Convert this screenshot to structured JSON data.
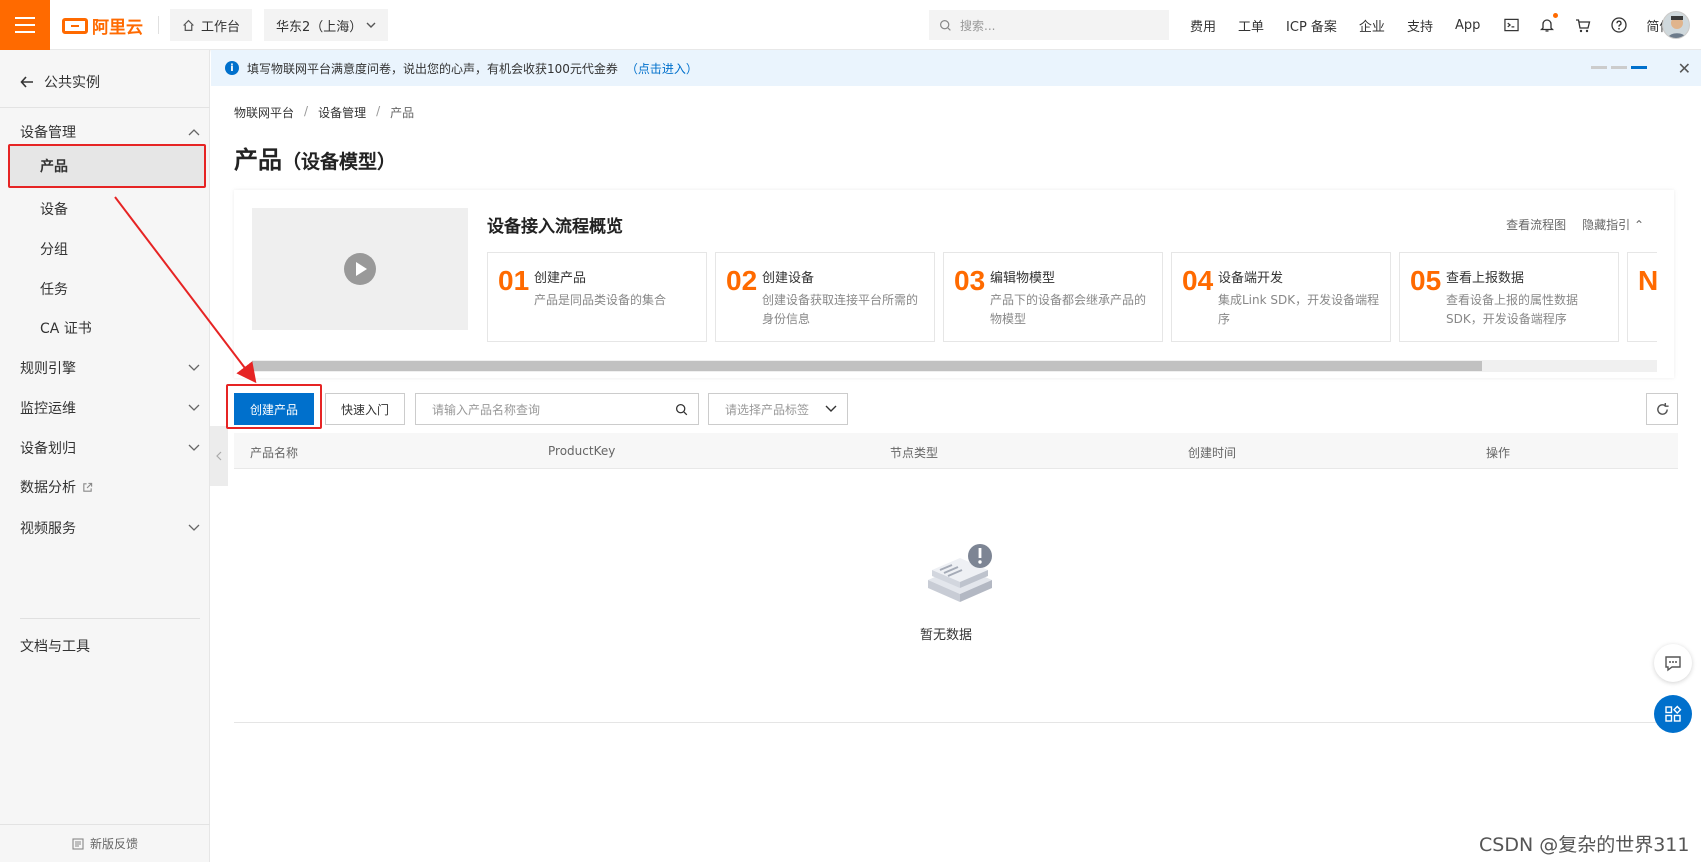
{
  "topbar": {
    "brand": "阿里云",
    "workbench_label": "工作台",
    "region_label": "华东2（上海）",
    "search_placeholder": "搜索...",
    "links": [
      "费用",
      "工单",
      "ICP 备案",
      "企业",
      "支持",
      "App"
    ],
    "language": "简体"
  },
  "sidebar": {
    "back_label": "公共实例",
    "group_device_mgmt": "设备管理",
    "items": [
      "产品",
      "设备",
      "分组",
      "任务",
      "CA 证书"
    ],
    "groups": [
      "规则引擎",
      "监控运维",
      "设备划归",
      "数据分析",
      "视频服务"
    ],
    "docs_label": "文档与工具",
    "feedback_label": "新版反馈"
  },
  "notice": {
    "text": "填写物联网平台满意度问卷，说出您的心声，有机会收获100元代金券",
    "link": "（点击进入）"
  },
  "breadcrumb": [
    "物联网平台",
    "设备管理",
    "产品"
  ],
  "page": {
    "title": "产品",
    "title_suffix": "（设备模型）"
  },
  "guide": {
    "title": "设备接入流程概览",
    "view_flow": "查看流程图",
    "hide_guide": "隐藏指引",
    "steps": [
      {
        "num": "01",
        "title": "创建产品",
        "desc": "产品是同品类设备的集合"
      },
      {
        "num": "02",
        "title": "创建设备",
        "desc": "创建设备获取连接平台所需的身份信息"
      },
      {
        "num": "03",
        "title": "编辑物模型",
        "desc": "产品下的设备都会继承产品的物模型"
      },
      {
        "num": "04",
        "title": "设备端开发",
        "desc": "集成Link SDK，开发设备端程序"
      },
      {
        "num": "05",
        "title": "查看上报数据",
        "desc": "查看设备上报的属性数据SDK，开发设备端程序"
      },
      {
        "num": "Nex",
        "title": "",
        "desc": ""
      }
    ]
  },
  "toolbar": {
    "create_label": "创建产品",
    "quickstart_label": "快速入门",
    "search_placeholder": "请输入产品名称查询",
    "tag_placeholder": "请选择产品标签"
  },
  "table": {
    "columns": [
      "产品名称",
      "ProductKey",
      "节点类型",
      "创建时间",
      "操作"
    ],
    "empty_text": "暂无数据"
  },
  "watermark": "CSDN @复杂的世界311",
  "colors": {
    "brand": "#ff6a00",
    "primary": "#0070cc",
    "highlight": "#e62424"
  }
}
